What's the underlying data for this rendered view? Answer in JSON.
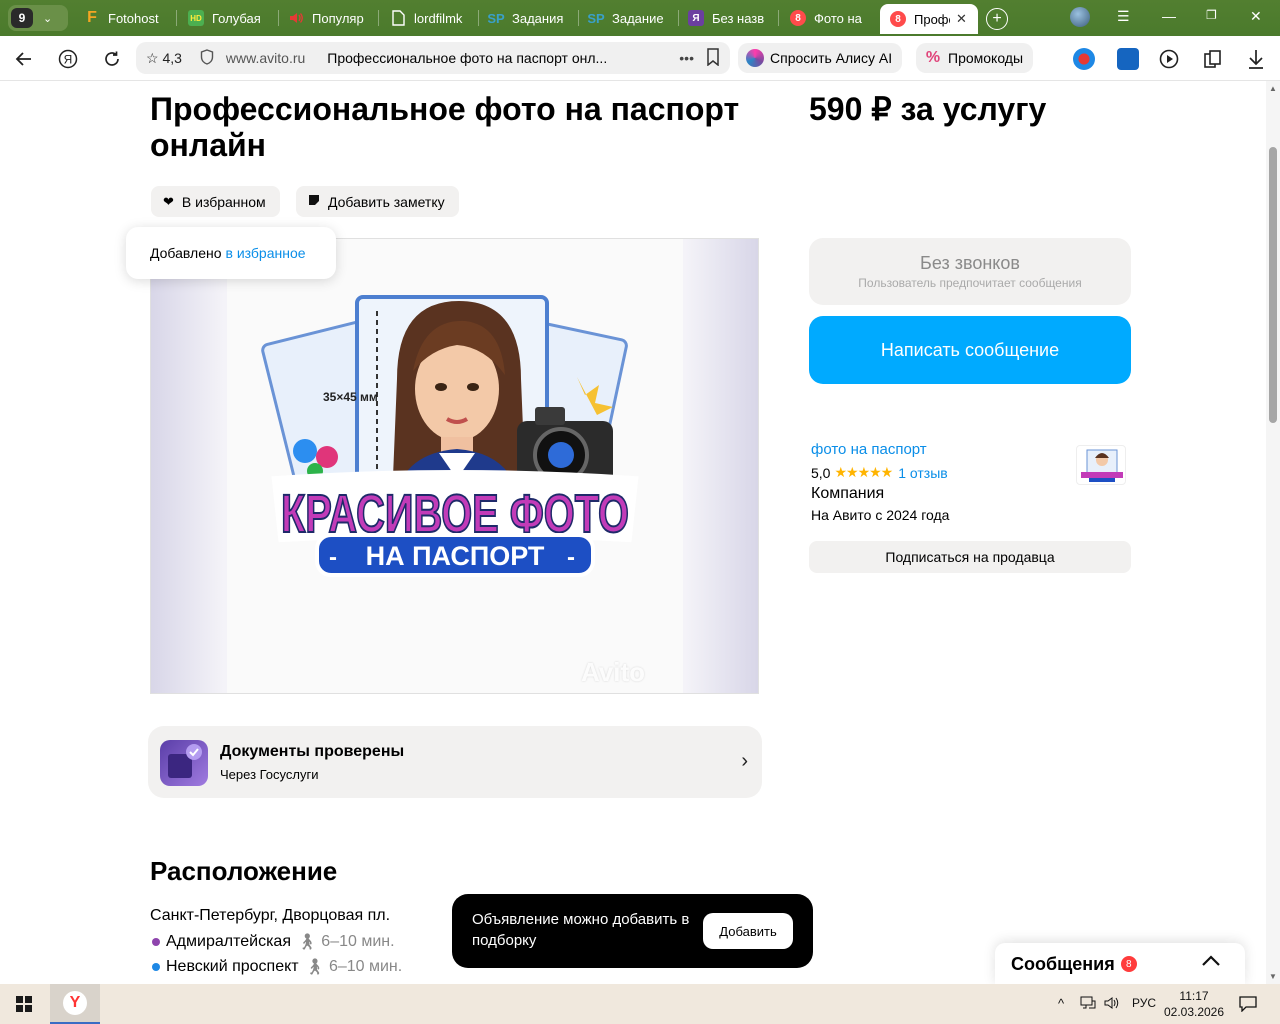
{
  "browser": {
    "tab_count": "9",
    "tabs": [
      {
        "title": "Fotohost",
        "favicon": "F",
        "color": "#f5a623"
      },
      {
        "title": "Голубая",
        "favicon": "HD",
        "color": "#4caf50"
      },
      {
        "title": "Популяр",
        "favicon": "volume-icon",
        "color": "#e53935"
      },
      {
        "title": "lordfilmk",
        "favicon": "doc-icon",
        "color": "#ffffff"
      },
      {
        "title": "Задания",
        "favicon": "SP",
        "color": "#3aa0c8"
      },
      {
        "title": "Задание",
        "favicon": "SP",
        "color": "#3aa0c8"
      },
      {
        "title": "Без назв",
        "favicon": "Я",
        "color": "#6b3fa0"
      },
      {
        "title": "Фото на",
        "favicon": "8",
        "color": "#ff4b4b"
      }
    ],
    "active_tab": {
      "title": "Профе",
      "favicon": "8"
    },
    "address": {
      "rating": "4,3",
      "domain": "www.avito.ru",
      "page_title": "Профессиональное фото на паспорт онл..."
    },
    "alice_label": "Спросить Алису AI",
    "promo_label": "Промокоды"
  },
  "listing": {
    "title": "Профессиональное фото на паспорт онлайн",
    "price": "590 ₽ за услугу",
    "favorite_label": "В избранном",
    "note_label": "Добавить заметку",
    "toast_text": "Добавлено",
    "toast_link": "в избранное",
    "watermark": "Avito",
    "image": {
      "size_label": "35×45 мм",
      "headline": "КРАСИВОЕ ФОТО",
      "subline": "НА ПАСПОРТ"
    },
    "docs_title": "Документы проверены",
    "docs_subtitle": "Через Госуслуги",
    "location_heading": "Расположение",
    "address": "Санкт-Петербург, Дворцовая пл.",
    "metro": [
      {
        "name": "Адмиралтейская",
        "time": "6–10 мин.",
        "color": "#8e44ad"
      },
      {
        "name": "Невский проспект",
        "time": "6–10 мин.",
        "color": "#1e88e5"
      }
    ]
  },
  "contact": {
    "no_calls_title": "Без звонков",
    "no_calls_sub": "Пользователь предпочитает сообщения",
    "write_label": "Написать сообщение"
  },
  "seller": {
    "name": "фото на паспорт",
    "rating": "5,0",
    "stars": "★★★★★",
    "reviews": "1 отзыв",
    "type": "Компания",
    "since": "На Авито с 2024 года",
    "subscribe_label": "Подписаться на продавца"
  },
  "snackbar": {
    "text": "Объявление можно добавить в подборку",
    "button": "Добавить"
  },
  "messages": {
    "label": "Сообщения",
    "count": "8"
  },
  "taskbar": {
    "lang": "РУС",
    "time": "11:17",
    "date": "02.03.2026"
  }
}
